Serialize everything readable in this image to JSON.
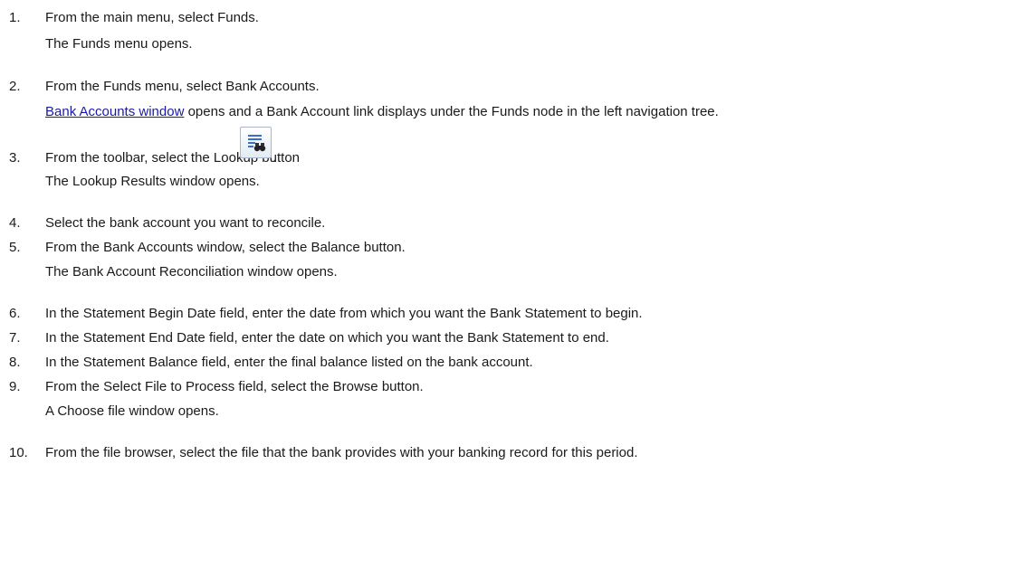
{
  "steps": [
    {
      "num": "1.",
      "text": "From the main menu, select Funds.",
      "result": "The Funds menu opens."
    },
    {
      "num": "2.",
      "text": "From the Funds menu, select  Bank Accounts.",
      "result_link": "Bank Accounts window",
      "result_rest": " opens and a Bank Account link displays under the Funds node in the left navigation tree."
    },
    {
      "num": "3.",
      "text": "From the toolbar, select the Lookup button",
      "text_after": ".",
      "result": "The Lookup Results window opens."
    },
    {
      "num": "4.",
      "text": "Select the bank account you want to reconcile."
    },
    {
      "num": "5.",
      "text": "From the Bank Accounts window, select the Balance button.",
      "result": "The Bank Account Reconciliation window opens."
    },
    {
      "num": "6.",
      "text": "In the Statement Begin Date field, enter the date from which you want the Bank Statement to begin."
    },
    {
      "num": "7.",
      "text": "In the Statement End Date field, enter the date on which you want the Bank Statement to end."
    },
    {
      "num": "8.",
      "text": "In the Statement Balance field, enter the final balance listed on the bank account."
    },
    {
      "num": "9.",
      "text": "From the Select File to Process field, select the Browse button.",
      "result": "A Choose file window opens."
    },
    {
      "num": "10.",
      "text": "From the file browser, select the file that the bank provides with your banking record for this period."
    }
  ],
  "icons": {
    "lookup": "lookup-binoculars-icon"
  },
  "colors": {
    "link": "#1a1aa8",
    "text": "#1a1a1a",
    "button_border": "#a9b7c9",
    "icon_lines": "#3a6fd0"
  }
}
